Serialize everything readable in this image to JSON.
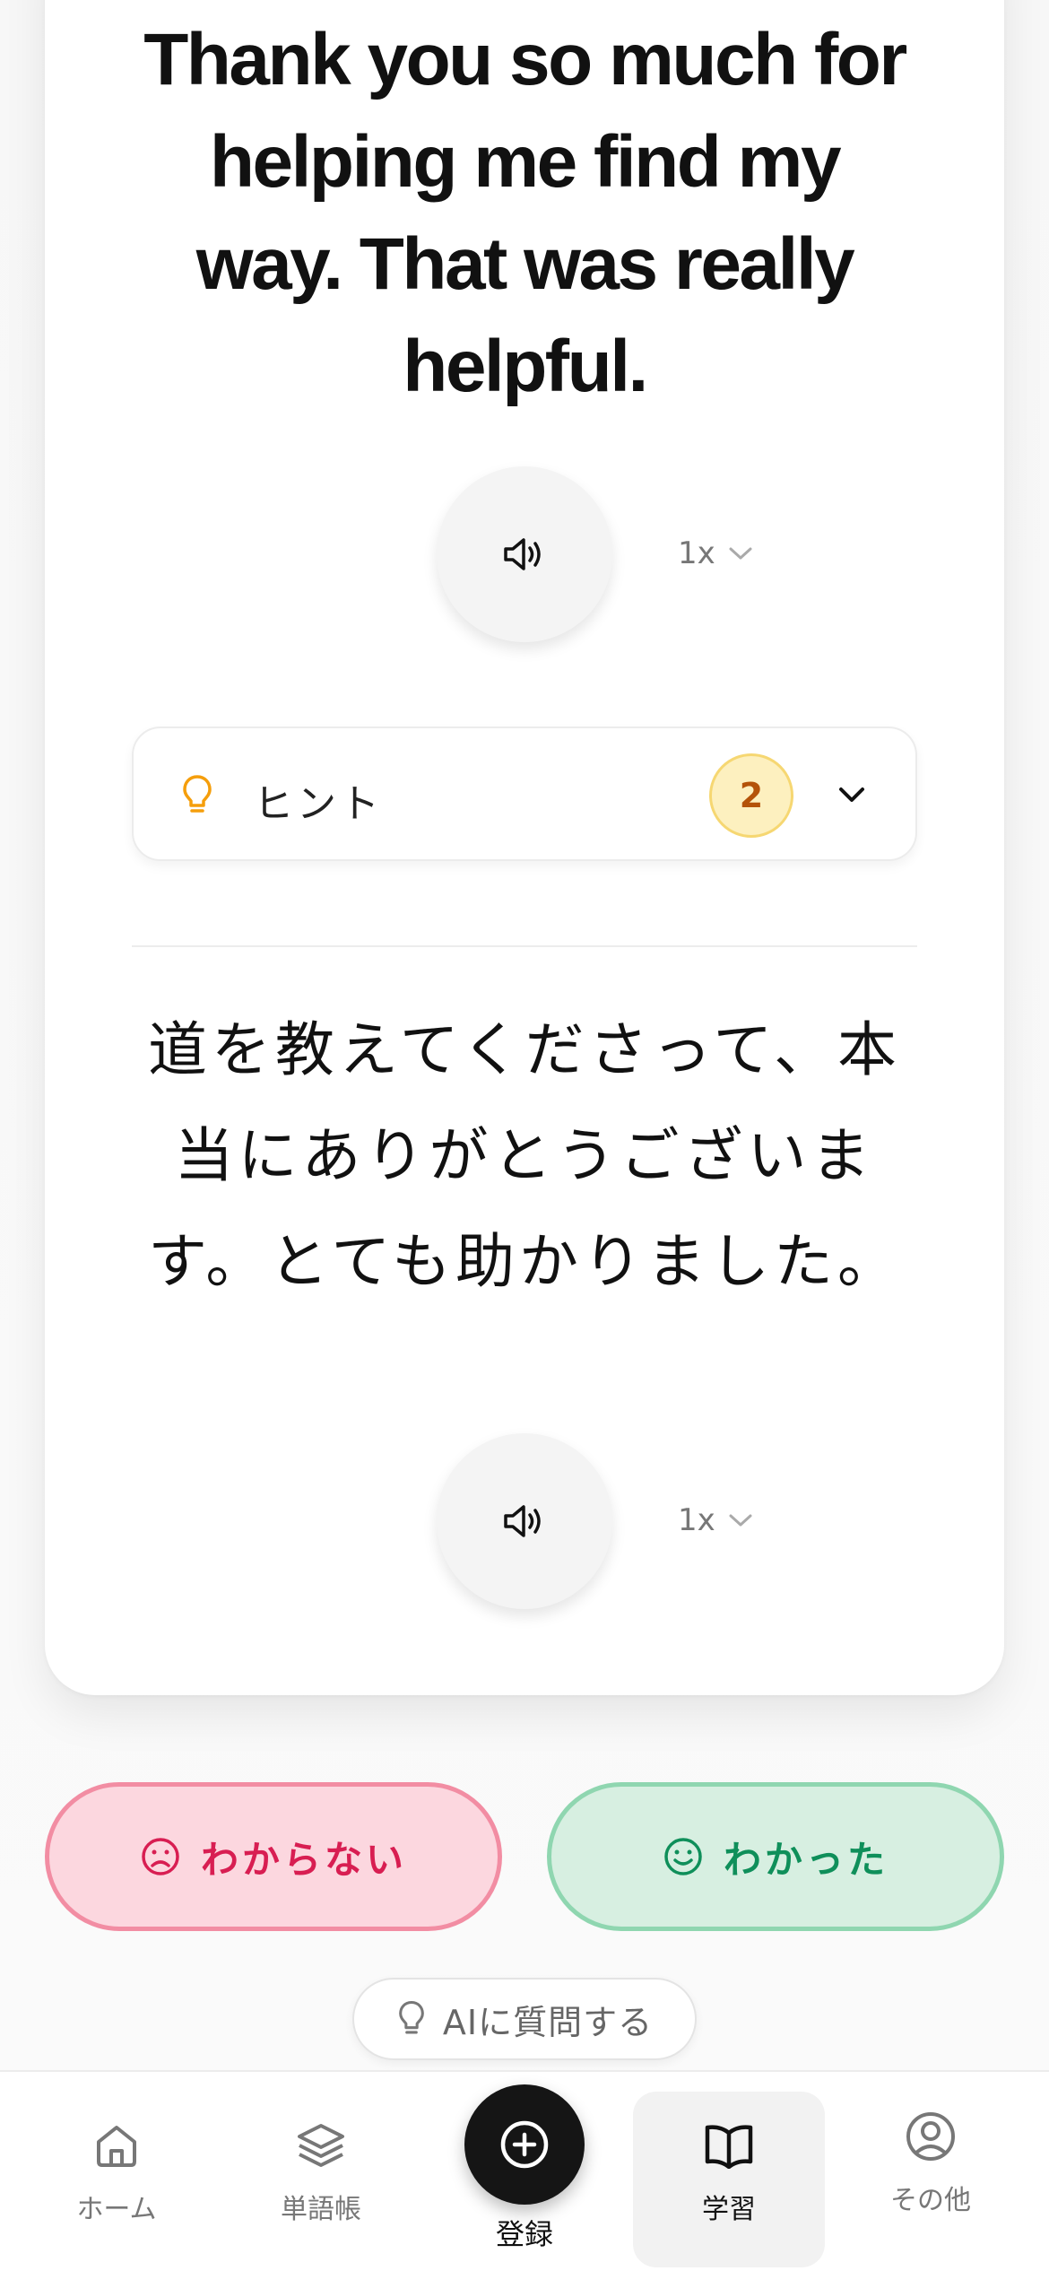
{
  "card": {
    "english_text": "Thank you so much for helping me find my way. That was really helpful.",
    "japanese_text": "道を教えてくださって、本当にありがとうございます。とても助かりました。",
    "audio_top": {
      "icon": "speaker-icon",
      "speed": "1x"
    },
    "audio_bottom": {
      "icon": "speaker-icon",
      "speed": "1x"
    },
    "hint": {
      "icon": "lightbulb-icon",
      "label": "ヒント",
      "count": "2"
    }
  },
  "answers": {
    "dont_know": {
      "label": "わからない",
      "icon": "sad-face-icon",
      "color": "#d81e52"
    },
    "know": {
      "label": "わかった",
      "icon": "smile-face-icon",
      "color": "#0f8f5a"
    }
  },
  "ai_button": {
    "label": "AIに質問する",
    "icon": "lightbulb-icon"
  },
  "nav": {
    "home": {
      "label": "ホーム",
      "icon": "home-icon"
    },
    "vocab": {
      "label": "単語帳",
      "icon": "layers-icon"
    },
    "register": {
      "label": "登録",
      "icon": "plus-circle-icon"
    },
    "study": {
      "label": "学習",
      "icon": "book-icon",
      "active": true
    },
    "more": {
      "label": "その他",
      "icon": "user-circle-icon"
    }
  }
}
